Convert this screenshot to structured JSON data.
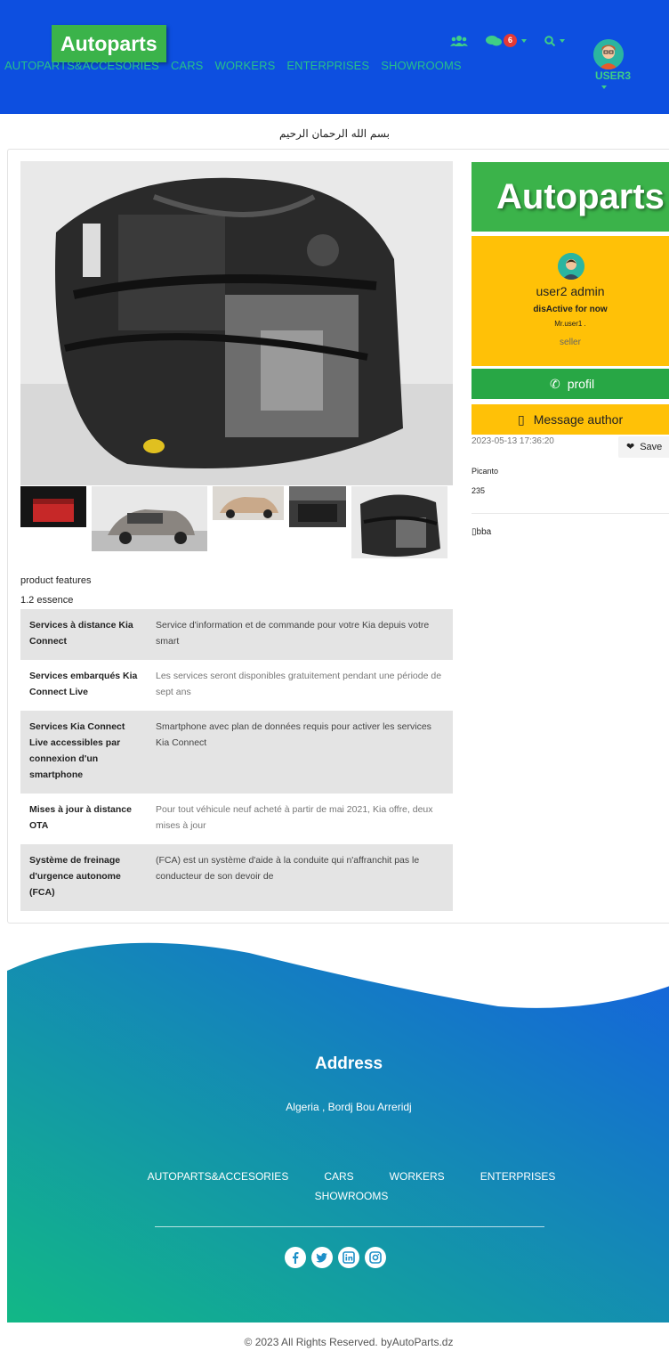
{
  "header": {
    "brand": "Autoparts",
    "nav": [
      "AUTOPARTS&ACCESORIES",
      "CARS",
      "WORKERS",
      "ENTERPRISES",
      "SHOWROOMS"
    ],
    "message_count": "6",
    "username": "USER3",
    "icons": [
      "users-icon",
      "chat-icon",
      "search-icon"
    ],
    "bg_color": "#0d4fe0",
    "accent_color": "#3fcf86"
  },
  "bismillah": "بسم الله الرحمان الرحيم",
  "product": {
    "features_title": "product features",
    "features_subtitle": "1.2 essence",
    "specs": [
      {
        "name": "Services à distance Kia Connect",
        "value": "Service d'information et de commande pour votre Kia depuis votre smart"
      },
      {
        "name": "Services embarqués Kia Connect Live",
        "value": "Les services seront disponibles gratuitement pendant une période de sept ans"
      },
      {
        "name": "Services Kia Connect Live accessibles par connexion d'un smartphone",
        "value": "Smartphone avec plan de données requis pour activer les services Kia Connect"
      },
      {
        "name": "Mises à jour à distance OTA",
        "value": "Pour tout véhicule neuf acheté à partir de mai 2021, Kia offre, deux mises à jour"
      },
      {
        "name": "Système de freinage d'urgence autonome (FCA)",
        "value": "(FCA) est un système d'aide à la conduite qui n'affranchit pas le conducteur de son devoir de"
      }
    ]
  },
  "sidebar": {
    "logo": "Autoparts",
    "author_name": "user2 admin",
    "author_status": "disActive for now",
    "author_title": "Mr.user1 .",
    "author_role": "seller",
    "profil_button": "profil",
    "message_button": "Message author",
    "date": "2023-05-13 17:36:20",
    "save_button": "Save",
    "model": "Picanto",
    "number": "235",
    "city": "bba",
    "green": "#28a745",
    "yellow": "#ffc107"
  },
  "footer": {
    "address_title": "Address",
    "address": "Algeria , Bordj Bou Arreridj",
    "links": [
      "AUTOPARTS&ACCESORIES",
      "CARS",
      "WORKERS",
      "ENTERPRISES",
      "SHOWROOMS"
    ],
    "socials": [
      "facebook-icon",
      "twitter-icon",
      "linkedin-icon",
      "instagram-icon"
    ],
    "copyright": "© 2023 All Rights Reserved. byAutoParts.dz",
    "gradient_from": "#12b886",
    "gradient_to": "#1560e0"
  }
}
